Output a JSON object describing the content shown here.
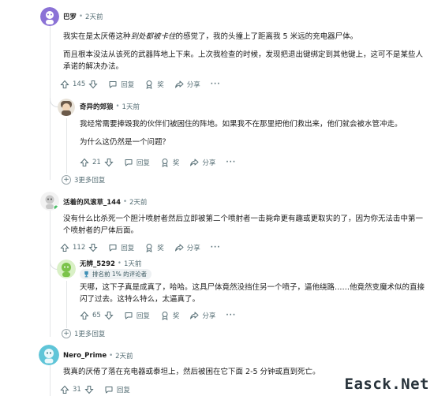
{
  "comments": [
    {
      "user": "巴罗",
      "time": "2天前",
      "avatar_color": "#8b72d6",
      "paragraphs": [
        [
          "我实在是太厌倦这种",
          "到处都被卡住",
          "的感觉了，我的头撞上了距离我 5 米远的充电器尸体。"
        ],
        [
          "而且根本没法从该死的武器阵地上下来。上次我检查的时候，发现把退出键绑定到其他键上，这可不是某些人承诺的解决办法。"
        ]
      ],
      "votes": "145",
      "reply": "回复",
      "award": "奖",
      "share": "分享"
    },
    {
      "user": "奇异的郊狼",
      "time": "1天前",
      "avatar_color": "#6b5a4a",
      "paragraphs": [
        [
          "我经常需要捧毁我的伙伴们被困住的阵地。如果我不在那里把他们救出来，他们就会被水管冲走。"
        ],
        [
          "为什么这仍然是一个问题？"
        ]
      ],
      "votes": "21",
      "reply": "回复",
      "award": "奖",
      "share": "分享",
      "more": "3更多回复"
    },
    {
      "user": "活着的风滚草_144",
      "time": "2天前",
      "avatar_color": "#c9c9c9",
      "paragraphs": [
        [
          "没有什么比杀死一个胆汁喷射者然后立即被第二个喷射者一击毙命更有趣或更取实的了，因为你无法击中第一个喷射者的尸体后面。"
        ]
      ],
      "votes": "112",
      "reply": "回复",
      "award": "奖",
      "share": "分享"
    },
    {
      "user": "无辨_5292",
      "time": "1天前",
      "avatar_color": "#7bc34a",
      "badge": "排名前 1% 的评论者",
      "paragraphs": [
        [
          "天哪，这下子真是成真了，哈哈。这具尸体竟然没挡住另一个喷子，逼他绕路……他竟然变魔术似的直接闪了过去。这特么特么，太逼真了。"
        ]
      ],
      "votes": "65",
      "reply": "回复",
      "award": "奖",
      "share": "分享",
      "more": "1更多回复"
    },
    {
      "user": "Nero_Prime",
      "time": "2天前",
      "avatar_color": "#5fc5d8",
      "paragraphs": [
        [
          "我真的厌倦了落在充电器或泰坦上，然后被困在它下面 2-5 分钟或直到死亡。"
        ]
      ],
      "votes": "31",
      "reply": "回复"
    }
  ],
  "watermark": "Easck.Net"
}
